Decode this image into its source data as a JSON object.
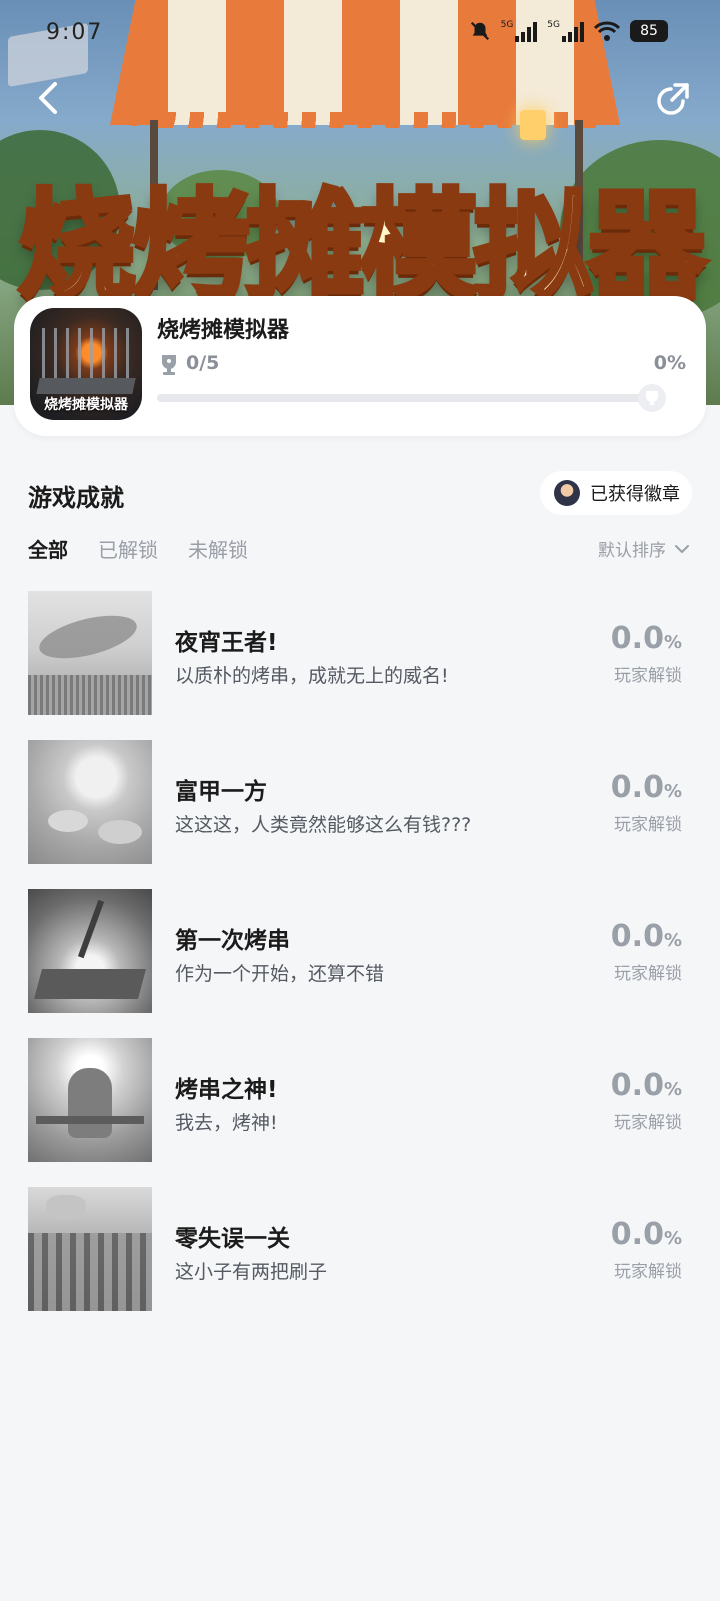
{
  "status_bar": {
    "time": "9:07",
    "network_1": "5G",
    "network_2": "5G",
    "battery": "85"
  },
  "hero": {
    "title": "烧烤摊模拟器"
  },
  "game": {
    "name": "烧烤摊模拟器",
    "icon_label": "烧烤摊模拟器",
    "progress_count": "0/5",
    "progress_percent": "0%",
    "progress_fraction": 0
  },
  "section": {
    "title": "游戏成就",
    "badge_button": "已获得徽章"
  },
  "tabs": [
    {
      "label": "全部",
      "active": true
    },
    {
      "label": "已解锁",
      "active": false
    },
    {
      "label": "未解锁",
      "active": false
    }
  ],
  "sort": {
    "label": "默认排序"
  },
  "achievements": [
    {
      "name": "夜宵王者!",
      "desc": "以质朴的烤串，成就无上的威名!",
      "rate": "0.0",
      "unit": "%",
      "caption": "玩家解锁"
    },
    {
      "name": "富甲一方",
      "desc": "这这这，人类竟然能够这么有钱???",
      "rate": "0.0",
      "unit": "%",
      "caption": "玩家解锁"
    },
    {
      "name": "第一次烤串",
      "desc": "作为一个开始，还算不错",
      "rate": "0.0",
      "unit": "%",
      "caption": "玩家解锁"
    },
    {
      "name": "烤串之神!",
      "desc": "我去，烤神!",
      "rate": "0.0",
      "unit": "%",
      "caption": "玩家解锁"
    },
    {
      "name": "零失误一关",
      "desc": "这小子有两把刷子",
      "rate": "0.0",
      "unit": "%",
      "caption": "玩家解锁"
    }
  ]
}
